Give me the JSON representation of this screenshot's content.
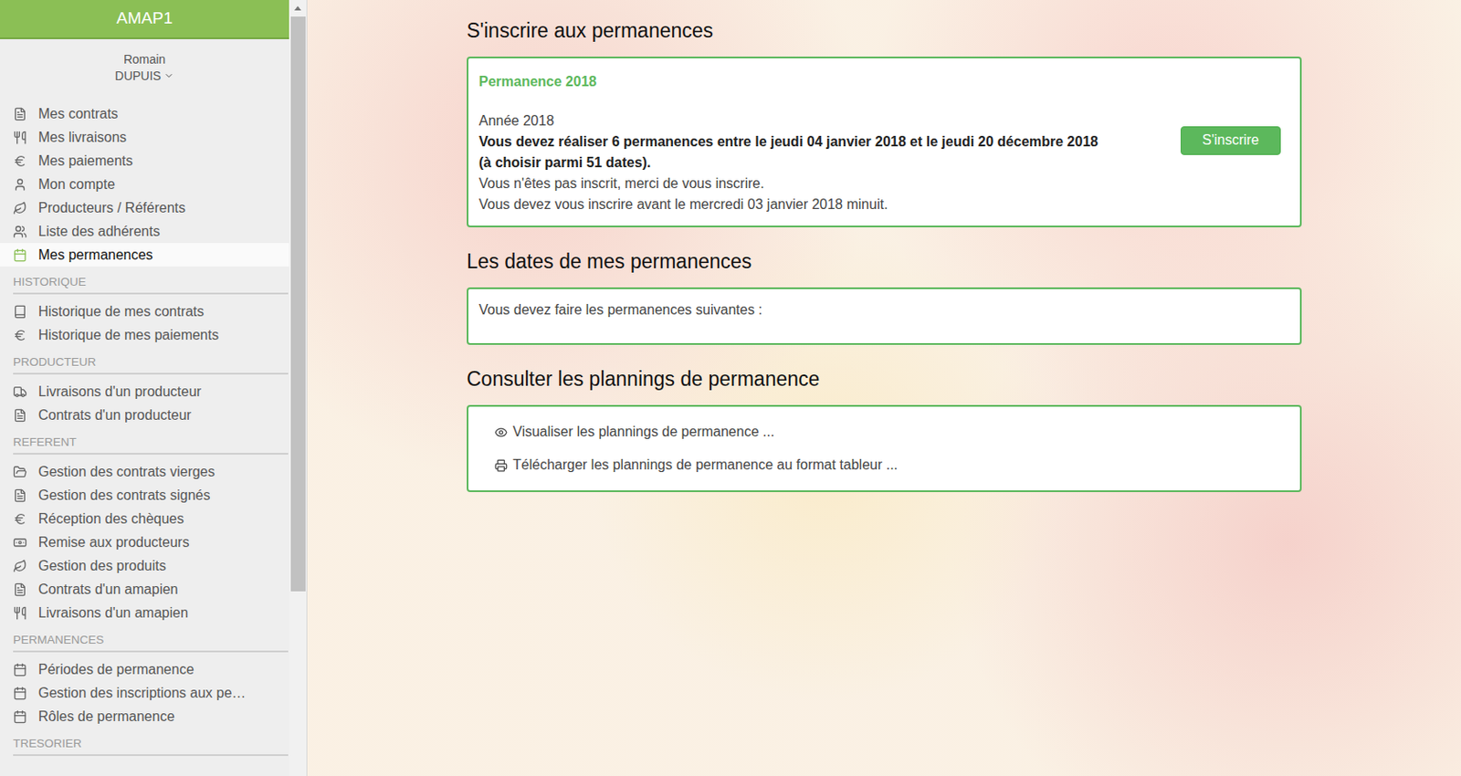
{
  "sidebar": {
    "title": "AMAP1",
    "user": {
      "first_name": "Romain",
      "last_name": "DUPUIS"
    },
    "items": [
      {
        "label": "Mes contrats",
        "selected": false
      },
      {
        "label": "Mes livraisons",
        "selected": false
      },
      {
        "label": "Mes paiements",
        "selected": false
      },
      {
        "label": "Mon compte",
        "selected": false
      },
      {
        "label": "Producteurs / Référents",
        "selected": false
      },
      {
        "label": "Liste des adhérents",
        "selected": false
      },
      {
        "label": "Mes permanences",
        "selected": true
      }
    ],
    "sections": [
      {
        "label": "HISTORIQUE",
        "items": [
          {
            "label": "Historique de mes contrats",
            "selected": false
          },
          {
            "label": "Historique de mes paiements",
            "selected": false
          }
        ]
      },
      {
        "label": "PRODUCTEUR",
        "items": [
          {
            "label": "Livraisons d'un producteur",
            "selected": false
          },
          {
            "label": "Contrats d'un producteur",
            "selected": false
          }
        ]
      },
      {
        "label": "REFERENT",
        "items": [
          {
            "label": "Gestion des contrats vierges",
            "selected": false
          },
          {
            "label": "Gestion des contrats signés",
            "selected": false
          },
          {
            "label": "Réception des chèques",
            "selected": false
          },
          {
            "label": "Remise aux producteurs",
            "selected": false
          },
          {
            "label": "Gestion des produits",
            "selected": false
          },
          {
            "label": "Contrats d'un amapien",
            "selected": false
          },
          {
            "label": "Livraisons d'un amapien",
            "selected": false
          }
        ]
      },
      {
        "label": "PERMANENCES",
        "items": [
          {
            "label": "Périodes de permanence",
            "selected": false
          },
          {
            "label": "Gestion des inscriptions aux pe…",
            "selected": false
          },
          {
            "label": "Rôles de permanence",
            "selected": false
          }
        ]
      },
      {
        "label": "TRESORIER",
        "items": []
      }
    ]
  },
  "main": {
    "register": {
      "title": "S'inscrire aux permanences",
      "card_title": "Permanence 2018",
      "lines": [
        {
          "text": "Année 2018",
          "bold": false
        },
        {
          "text": "Vous devez réaliser 6 permanences entre le jeudi 04 janvier 2018 et le jeudi 20 décembre 2018",
          "bold": true
        },
        {
          "text": "(à choisir parmi 51 dates).",
          "bold": true
        },
        {
          "text": "Vous n'êtes pas inscrit, merci de vous inscrire.",
          "bold": false
        },
        {
          "text": "Vous devez vous inscrire avant le mercredi 03 janvier 2018 minuit.",
          "bold": false
        }
      ],
      "button": "S'inscrire"
    },
    "dates": {
      "title": "Les dates de mes permanences",
      "text": "Vous devez faire les permanences suivantes :"
    },
    "plannings": {
      "title": "Consulter les plannings de permanence",
      "links": [
        "Visualiser les plannings de permanence ...",
        "Télécharger les plannings de permanence au format tableur ..."
      ]
    }
  }
}
